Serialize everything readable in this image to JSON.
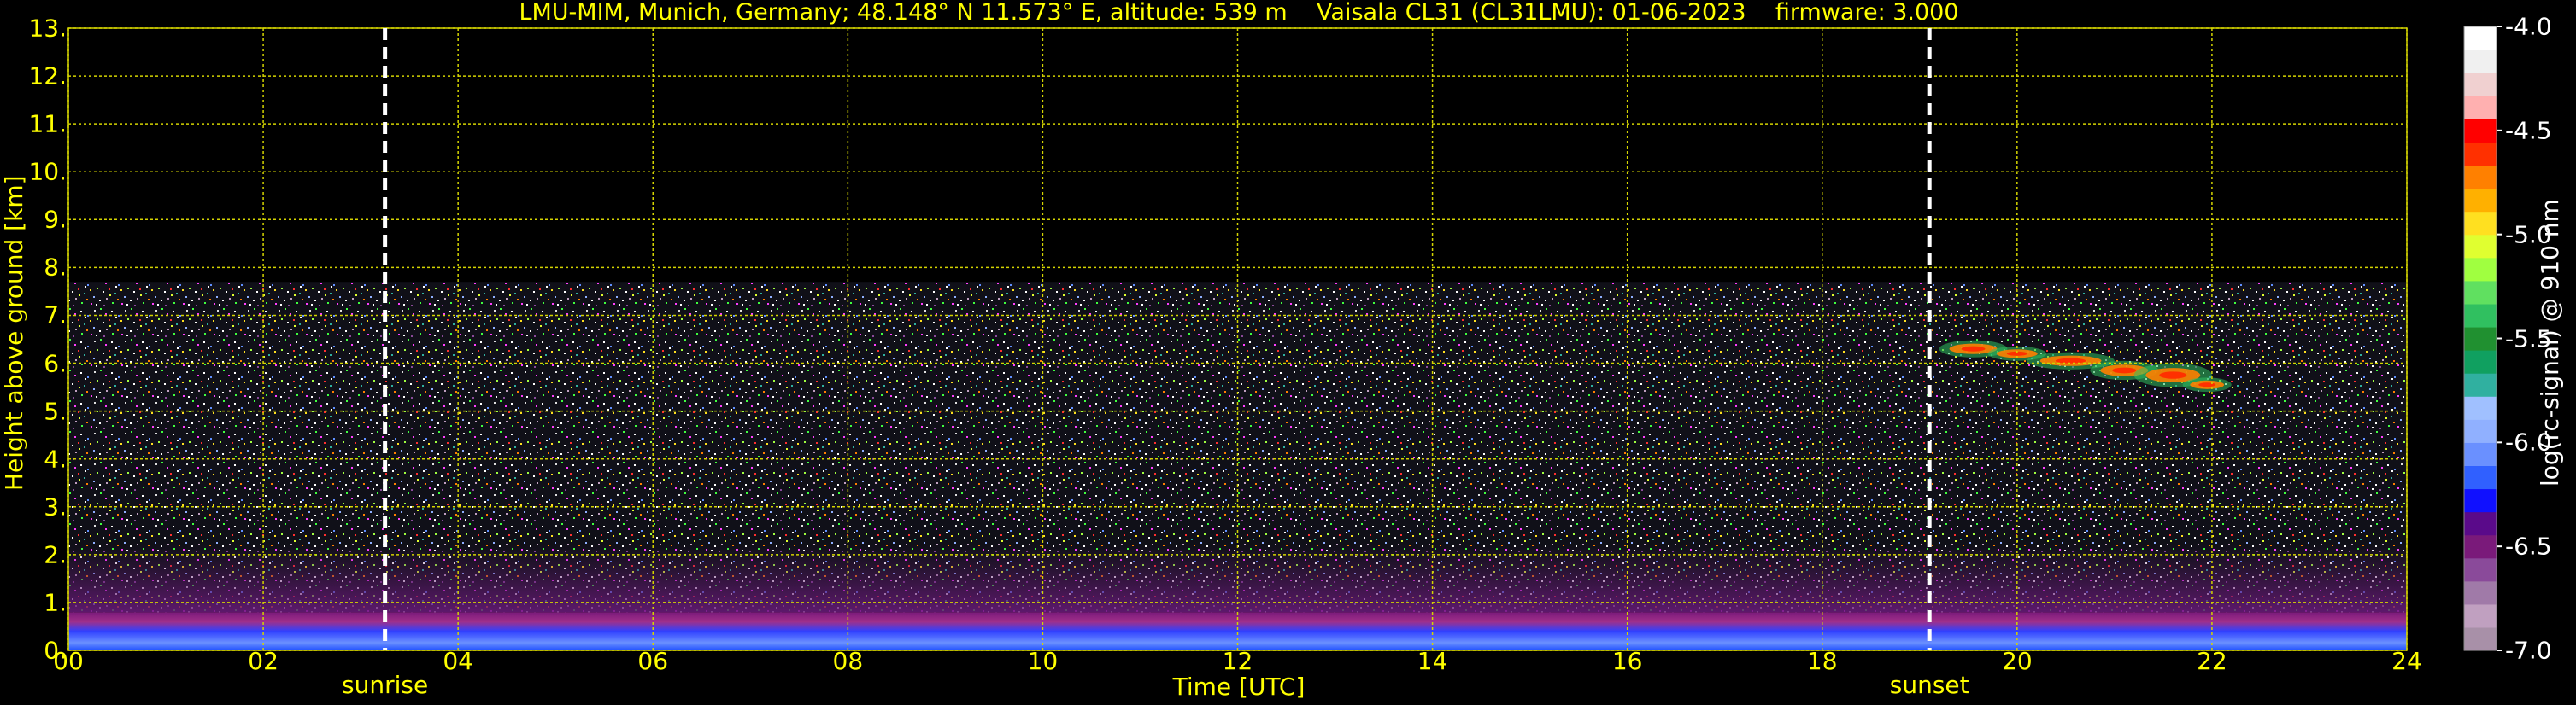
{
  "header": {
    "title": "LMU-MIM, Munich, Germany; 48.148° N 11.573° E, altitude: 539 m    Vaisala CL31 (CL31LMU): 01-06-2023    firmware: 3.000"
  },
  "chart_data": {
    "type": "heatmap",
    "xlabel": "Time [UTC]",
    "ylabel": "Height above ground [km]",
    "xlim": [
      0,
      24
    ],
    "ylim": [
      0,
      13
    ],
    "x_ticks": [
      "00",
      "02",
      "04",
      "06",
      "08",
      "10",
      "12",
      "14",
      "16",
      "18",
      "20",
      "22",
      "24"
    ],
    "y_ticks": [
      "0.",
      "1.",
      "2.",
      "3.",
      "4.",
      "5.",
      "6.",
      "7.",
      "8.",
      "9.",
      "10.",
      "11.",
      "12.",
      "13."
    ],
    "grid": true,
    "events": [
      {
        "label": "sunrise",
        "time_h": 3.25
      },
      {
        "label": "sunset",
        "time_h": 19.1
      }
    ],
    "colorbar": {
      "label": "log(rc-signal) @ 910 nm",
      "range": [
        -7.0,
        -4.0
      ],
      "ticks": [
        "-4.0",
        "-4.5",
        "-5.0",
        "-5.5",
        "-6.0",
        "-6.5",
        "-7.0"
      ],
      "colors": [
        "#a890a8",
        "#c0a0c0",
        "#a07aa8",
        "#8a4a9a",
        "#7a1a7a",
        "#5a0a8a",
        "#1010ff",
        "#3060ff",
        "#6a90ff",
        "#90b0ff",
        "#a0c0ff",
        "#30b0a0",
        "#10a060",
        "#209030",
        "#30c060",
        "#60e060",
        "#a0ff40",
        "#e0ff30",
        "#ffe020",
        "#ffb000",
        "#ff8000",
        "#ff3000",
        "#ff0000",
        "#ffb0b0",
        "#f0d0d0",
        "#f0f0f0",
        "#ffffff"
      ]
    },
    "features": [
      {
        "label": "boundary_layer",
        "time_h": [
          0,
          24
        ],
        "height_km": [
          0,
          0.8
        ]
      },
      {
        "label": "noise_region",
        "time_h": [
          0,
          24
        ],
        "height_km": [
          0.8,
          7.7
        ]
      },
      {
        "label": "cloud_layer",
        "time_h": [
          19.5,
          22.2
        ],
        "height_km": [
          5.4,
          6.4
        ]
      }
    ]
  }
}
